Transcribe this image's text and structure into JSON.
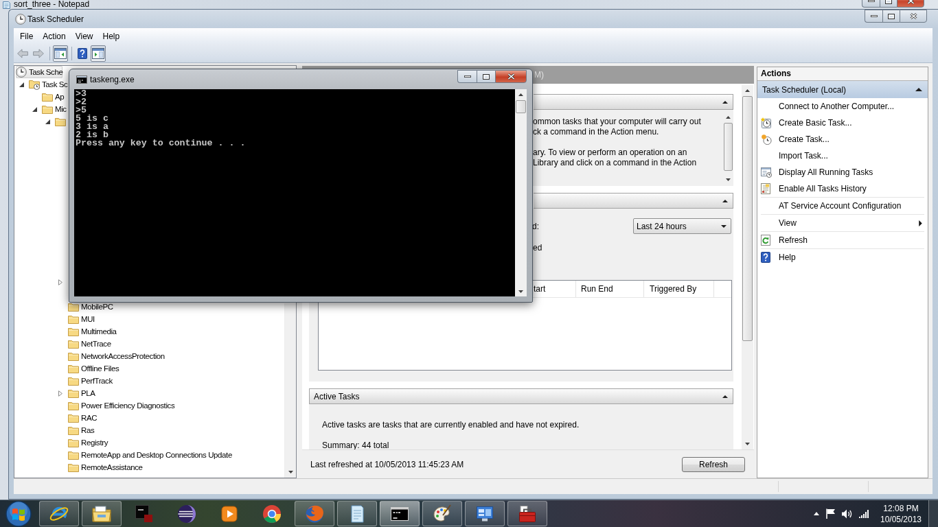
{
  "background_window": {
    "title": "sort_three - Notepad"
  },
  "window": {
    "title": "Task Scheduler"
  },
  "menu": [
    {
      "label": "File"
    },
    {
      "label": "Action"
    },
    {
      "label": "View"
    },
    {
      "label": "Help"
    }
  ],
  "toolbar": [
    {
      "kind": "back",
      "disabled": true,
      "pressed": false
    },
    {
      "kind": "forward",
      "disabled": true,
      "pressed": false
    },
    {
      "kind": "separator"
    },
    {
      "kind": "console-tree",
      "disabled": false,
      "pressed": true
    },
    {
      "kind": "separator"
    },
    {
      "kind": "help",
      "disabled": false,
      "pressed": false
    },
    {
      "kind": "action-pane",
      "disabled": false,
      "pressed": true
    }
  ],
  "tree": [
    {
      "kind": "root",
      "label": "Task Sche",
      "selected": true,
      "children": [
        {
          "kind": "library",
          "label": "Task Sc",
          "selected": false,
          "expanded": true,
          "children": [
            {
              "kind": "folder",
              "label": "Ap",
              "selected": false
            },
            {
              "kind": "folder",
              "label": "Mic",
              "selected": false,
              "expanded": true,
              "children": [
                {
                  "kind": "folder",
                  "selected": false,
                  "expanded": true,
                  "children": [
                    {
                      "kind": "covered",
                      "expanded": false
                    },
                    {
                      "kind": "folder",
                      "label": "MobilePC",
                      "selected": false
                    },
                    {
                      "kind": "folder",
                      "label": "MUI",
                      "selected": false
                    },
                    {
                      "kind": "folder",
                      "label": "Multimedia",
                      "selected": false
                    },
                    {
                      "kind": "folder",
                      "label": "NetTrace",
                      "selected": false
                    },
                    {
                      "kind": "folder",
                      "label": "NetworkAccessProtection",
                      "selected": false
                    },
                    {
                      "kind": "folder",
                      "label": "Offline Files",
                      "selected": false
                    },
                    {
                      "kind": "folder",
                      "label": "PerfTrack",
                      "selected": false
                    },
                    {
                      "kind": "folder",
                      "label": "PLA",
                      "selected": false,
                      "expanded": false
                    },
                    {
                      "kind": "folder",
                      "label": "Power Efficiency Diagnostics",
                      "selected": false
                    },
                    {
                      "kind": "folder",
                      "label": "RAC",
                      "selected": false
                    },
                    {
                      "kind": "folder",
                      "label": "Ras",
                      "selected": false
                    },
                    {
                      "kind": "folder",
                      "label": "Registry",
                      "selected": false
                    },
                    {
                      "kind": "folder",
                      "label": "RemoteApp and Desktop Connections Update",
                      "selected": false
                    },
                    {
                      "kind": "folder",
                      "label": "RemoteAssistance",
                      "selected": false
                    }
                  ]
                }
              ]
            }
          ]
        }
      ]
    }
  ],
  "summary": {
    "title": "M)",
    "sections": [
      {
        "kind": "overview",
        "expanded": true,
        "paragraphs": [
          [
            "ommon tasks that your computer will carry out",
            "ck a command in the Action menu."
          ],
          [
            "ary. To view or perform an operation on an",
            "Library and click on a command in the Action"
          ]
        ]
      },
      {
        "kind": "status",
        "expanded": true,
        "period_label": "d:",
        "period": "Last 24 hours",
        "summary": "ed",
        "columns": [
          "tart",
          "Run End",
          "Triggered By"
        ]
      },
      {
        "kind": "active",
        "title": "Active Tasks",
        "expanded": true,
        "lines": [
          "Active tasks are tasks that are currently enabled and have not expired.",
          "Summary: 44 total"
        ]
      }
    ],
    "last_refreshed": "Last refreshed at 10/05/2013 11:45:23 AM",
    "refresh_button": "Refresh"
  },
  "actions": {
    "title": "Actions",
    "group": {
      "label": "Task Scheduler (Local)",
      "expanded": true
    },
    "items": [
      {
        "kind": "plain",
        "label": "Connect to Another Computer...",
        "rule_below": false
      },
      {
        "kind": "basic-task",
        "label": "Create Basic Task...",
        "rule_below": false
      },
      {
        "kind": "task",
        "label": "Create Task...",
        "rule_below": false
      },
      {
        "kind": "plain",
        "label": "Import Task...",
        "rule_below": false
      },
      {
        "kind": "running",
        "label": "Display All Running Tasks",
        "rule_below": false
      },
      {
        "kind": "history",
        "label": "Enable All Tasks History",
        "rule_below": true
      },
      {
        "kind": "plain",
        "label": "AT Service Account Configuration",
        "rule_below": true
      },
      {
        "kind": "submenu",
        "label": "View",
        "rule_below": true
      },
      {
        "kind": "refresh",
        "label": "Refresh",
        "rule_below": true
      },
      {
        "kind": "help",
        "label": "Help",
        "rule_below": false
      }
    ]
  },
  "console": {
    "title": "taskeng.exe",
    "lines": [
      ">3",
      ">2",
      ">5",
      "5 is c",
      "3 is a",
      "2 is b",
      "Press any key to continue . . ."
    ]
  },
  "taskbar": {
    "apps": [
      {
        "kind": "ie",
        "running": true,
        "selected": false
      },
      {
        "kind": "explorer",
        "running": true,
        "selected": false
      },
      {
        "kind": "squares",
        "running": false,
        "selected": false
      },
      {
        "kind": "sphere",
        "running": false,
        "selected": false
      },
      {
        "kind": "media",
        "running": false,
        "selected": false
      },
      {
        "kind": "chrome",
        "running": false,
        "selected": false
      },
      {
        "kind": "firefox",
        "running": true,
        "selected": false
      },
      {
        "kind": "notepad",
        "running": true,
        "selected": false
      },
      {
        "kind": "console",
        "running": true,
        "selected": true
      },
      {
        "kind": "paint",
        "running": true,
        "selected": false
      },
      {
        "kind": "panel",
        "running": true,
        "selected": false
      },
      {
        "kind": "toolbox",
        "running": true,
        "selected": false
      }
    ],
    "tray": [
      {
        "kind": "caret"
      },
      {
        "kind": "flag"
      },
      {
        "kind": "speaker"
      },
      {
        "kind": "signal"
      }
    ],
    "time": "12:08 PM",
    "date": "10/05/2013"
  }
}
